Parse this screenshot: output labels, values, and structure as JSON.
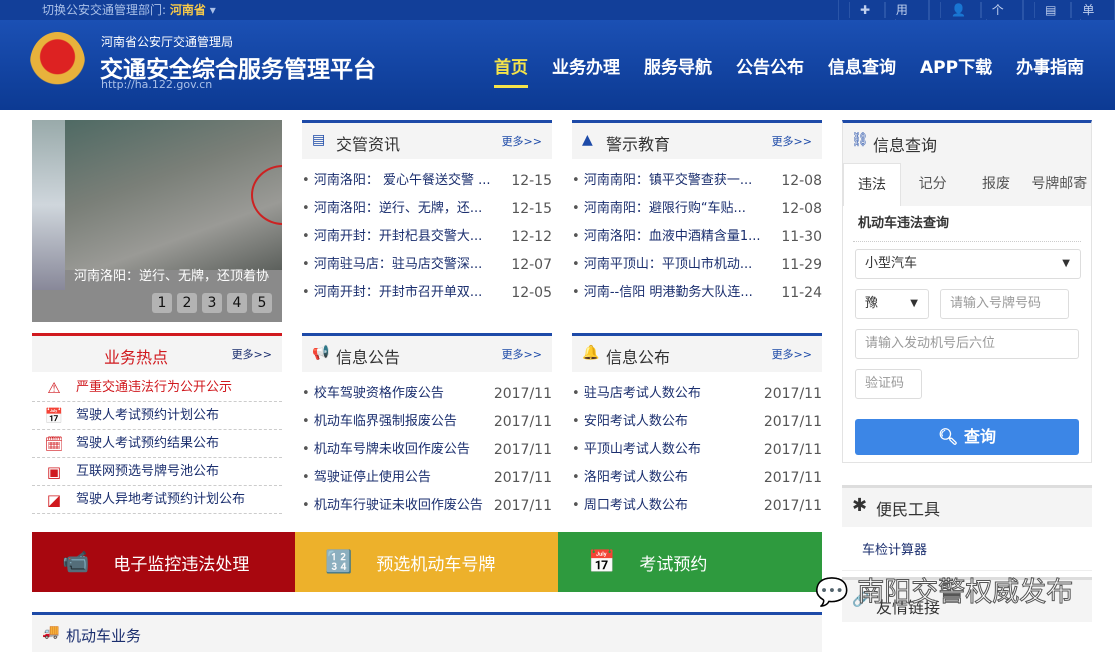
{
  "topbar": {
    "switch_label": "切换公安交通管理部门:",
    "province": "河南省",
    "register": "用户注册",
    "personal_login": "个人登录",
    "unit_login": "单位登录"
  },
  "header": {
    "org": "河南省公安厅交通管理局",
    "title": "交通安全综合服务管理平台",
    "url": "http://ha.122.gov.cn"
  },
  "nav": [
    "首页",
    "业务办理",
    "服务导航",
    "公告公布",
    "信息查询",
    "APP下载",
    "办事指南"
  ],
  "slider": {
    "caption": "河南洛阳：逆行、无牌，还顶着协",
    "pages": [
      "1",
      "2",
      "3",
      "4",
      "5"
    ]
  },
  "more": "更多>>",
  "news": {
    "title": "交管资讯",
    "items": [
      {
        "t": "河南洛阳： 爱心午餐送交警 ...",
        "d": "12-15"
      },
      {
        "t": "河南洛阳：逆行、无牌，还...",
        "d": "12-15"
      },
      {
        "t": "河南开封：开封杞县交警大...",
        "d": "12-12"
      },
      {
        "t": "河南驻马店：驻马店交警深...",
        "d": "12-07"
      },
      {
        "t": "河南开封：开封市召开单双...",
        "d": "12-05"
      }
    ]
  },
  "warning": {
    "title": "警示教育",
    "items": [
      {
        "t": "河南南阳：镇平交警查获一...",
        "d": "12-08"
      },
      {
        "t": "河南南阳：避限行购“车贴...",
        "d": "12-08"
      },
      {
        "t": "河南洛阳：血液中酒精含量1...",
        "d": "11-30"
      },
      {
        "t": "河南平顶山：平顶山市机动...",
        "d": "11-29"
      },
      {
        "t": "河南--信阳 明港勤务大队连...",
        "d": "11-24"
      }
    ]
  },
  "hot": {
    "title": "业务热点",
    "items": [
      "严重交通违法行为公开公示",
      "驾驶人考试预约计划公布",
      "驾驶人考试预约结果公布",
      "互联网预选号牌号池公布",
      "驾驶人异地考试预约计划公布"
    ]
  },
  "notice": {
    "title": "信息公告",
    "items": [
      {
        "t": "校车驾驶资格作废公告",
        "d": "2017/11"
      },
      {
        "t": "机动车临界强制报废公告",
        "d": "2017/11"
      },
      {
        "t": "机动车号牌未收回作废公告",
        "d": "2017/11"
      },
      {
        "t": "驾驶证停止使用公告",
        "d": "2017/11"
      },
      {
        "t": "机动车行驶证未收回作废公告",
        "d": "2017/11"
      }
    ]
  },
  "publish": {
    "title": "信息公布",
    "items": [
      {
        "t": "驻马店考试人数公布",
        "d": "2017/11"
      },
      {
        "t": "安阳考试人数公布",
        "d": "2017/11"
      },
      {
        "t": "平顶山考试人数公布",
        "d": "2017/11"
      },
      {
        "t": "洛阳考试人数公布",
        "d": "2017/11"
      },
      {
        "t": "周口考试人数公布",
        "d": "2017/11"
      }
    ]
  },
  "banners": [
    {
      "label": "电子监控违法处理",
      "color": "#a8070f"
    },
    {
      "label": "预选机动车号牌",
      "color": "#edb12b"
    },
    {
      "label": "考试预约",
      "color": "#2e9a3e"
    }
  ],
  "query": {
    "title": "信息查询",
    "tabs": [
      "违法",
      "记分",
      "报废",
      "号牌邮寄"
    ],
    "subtitle": "机动车违法查询",
    "vehicle_type": "小型汽车",
    "province_prefix": "豫",
    "plate_placeholder": "请输入号牌号码",
    "engine_placeholder": "请输入发动机号后六位",
    "captcha_placeholder": "验证码",
    "submit": "查询"
  },
  "tools": {
    "title": "便民工具",
    "items": [
      "车检计算器"
    ]
  },
  "links": {
    "title": "友情链接"
  },
  "vehicle": {
    "title": "机动车业务"
  },
  "watermark": "南阳交警权威发布"
}
